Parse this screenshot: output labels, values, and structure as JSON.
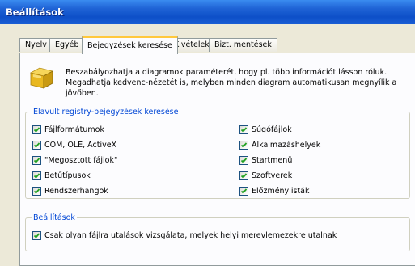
{
  "window": {
    "title": "Beállítások"
  },
  "tabs": [
    {
      "label": "Nyelv",
      "active": false
    },
    {
      "label": "Egyéb",
      "active": false
    },
    {
      "label": "Bejegyzések keresése",
      "active": true
    },
    {
      "label": "Kivételek",
      "active": false
    },
    {
      "label": "Bizt. mentések",
      "active": false
    }
  ],
  "description": "Beszabályozhatja a diagramok paraméterét, hogy pl. több információt lásson róluk. Megadhatja kedvenc-nézetét is, melyben minden diagram automatikusan megnyílik a jövőben.",
  "registry_group": {
    "title": "Elavult registry-bejegyzések keresése",
    "left": [
      {
        "label": "Fájlformátumok",
        "checked": true
      },
      {
        "label": "COM, OLE, ActiveX",
        "checked": true
      },
      {
        "label": "\"Megosztott fájlok\"",
        "checked": true
      },
      {
        "label": "Betűtípusok",
        "checked": true
      },
      {
        "label": "Rendszerhangok",
        "checked": true
      }
    ],
    "right": [
      {
        "label": "Súgófájlok",
        "checked": true
      },
      {
        "label": "Alkalmazáshelyek",
        "checked": true
      },
      {
        "label": "Startmenü",
        "checked": true
      },
      {
        "label": "Szoftverek",
        "checked": true
      },
      {
        "label": "Előzménylisták",
        "checked": true
      }
    ]
  },
  "settings_group": {
    "title": "Beállítások",
    "option": {
      "label": "Csak olyan fájlra utalások vizsgálata, melyek helyi merevlemezekre utalnak",
      "checked": true
    }
  },
  "colors": {
    "accent": "#0046d5",
    "title_bar": "#0d4fc8",
    "tab_highlight": "#ffc83c",
    "check": "#21a121"
  }
}
